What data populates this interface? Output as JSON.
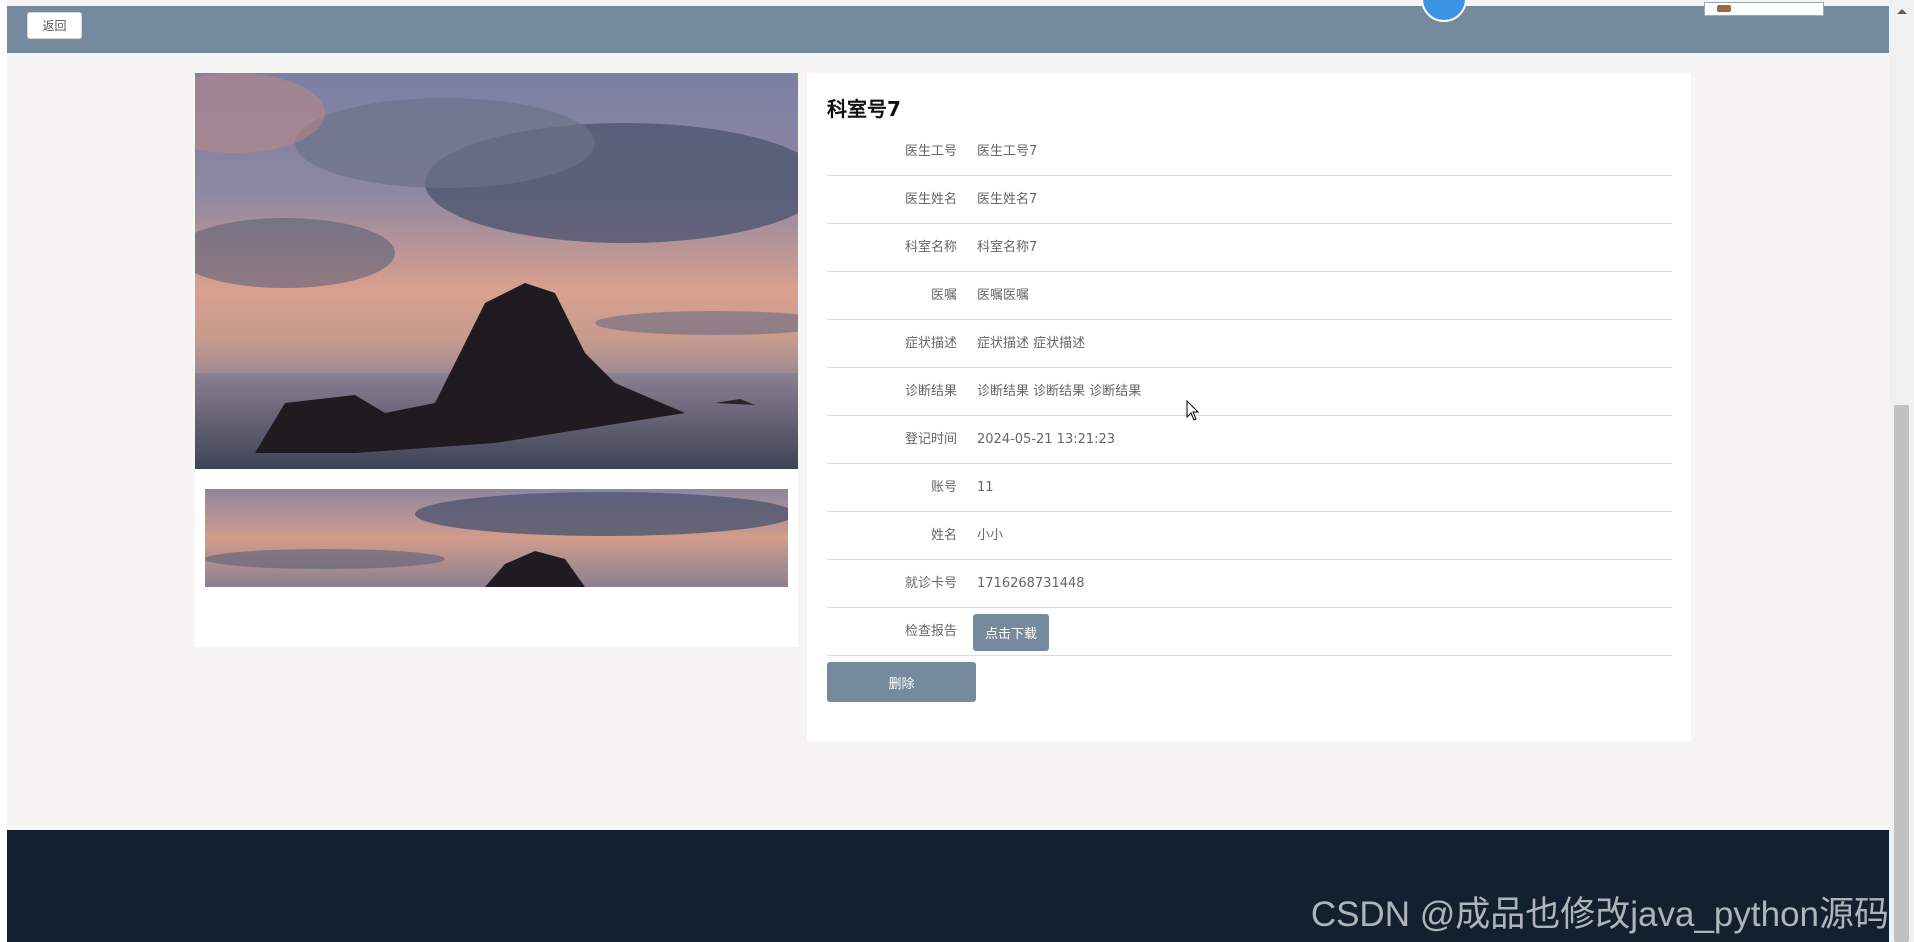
{
  "header": {
    "back_label": "返回"
  },
  "detail": {
    "title": "科室号7",
    "fields": [
      {
        "label": "医生工号",
        "value": "医生工号7"
      },
      {
        "label": "医生姓名",
        "value": "医生姓名7"
      },
      {
        "label": "科室名称",
        "value": "科室名称7"
      },
      {
        "label": "医嘱",
        "value": "医嘱医嘱"
      },
      {
        "label": "症状描述",
        "value": "症状描述 症状描述"
      },
      {
        "label": "诊断结果",
        "value": "诊断结果 诊断结果 诊断结果"
      },
      {
        "label": "登记时间",
        "value": "2024-05-21 13:21:23"
      },
      {
        "label": "账号",
        "value": "11"
      },
      {
        "label": "姓名",
        "value": "小小"
      },
      {
        "label": "就诊卡号",
        "value": "1716268731448"
      },
      {
        "label": "检查报告",
        "value": ""
      }
    ],
    "download_label": "点击下载",
    "delete_label": "删除"
  },
  "footer": {
    "watermark": "CSDN @成品也修改java_python源码"
  },
  "colors": {
    "accent": "#768a9d",
    "footer_bg": "#13202f",
    "page_bg": "#f6f5f4"
  }
}
